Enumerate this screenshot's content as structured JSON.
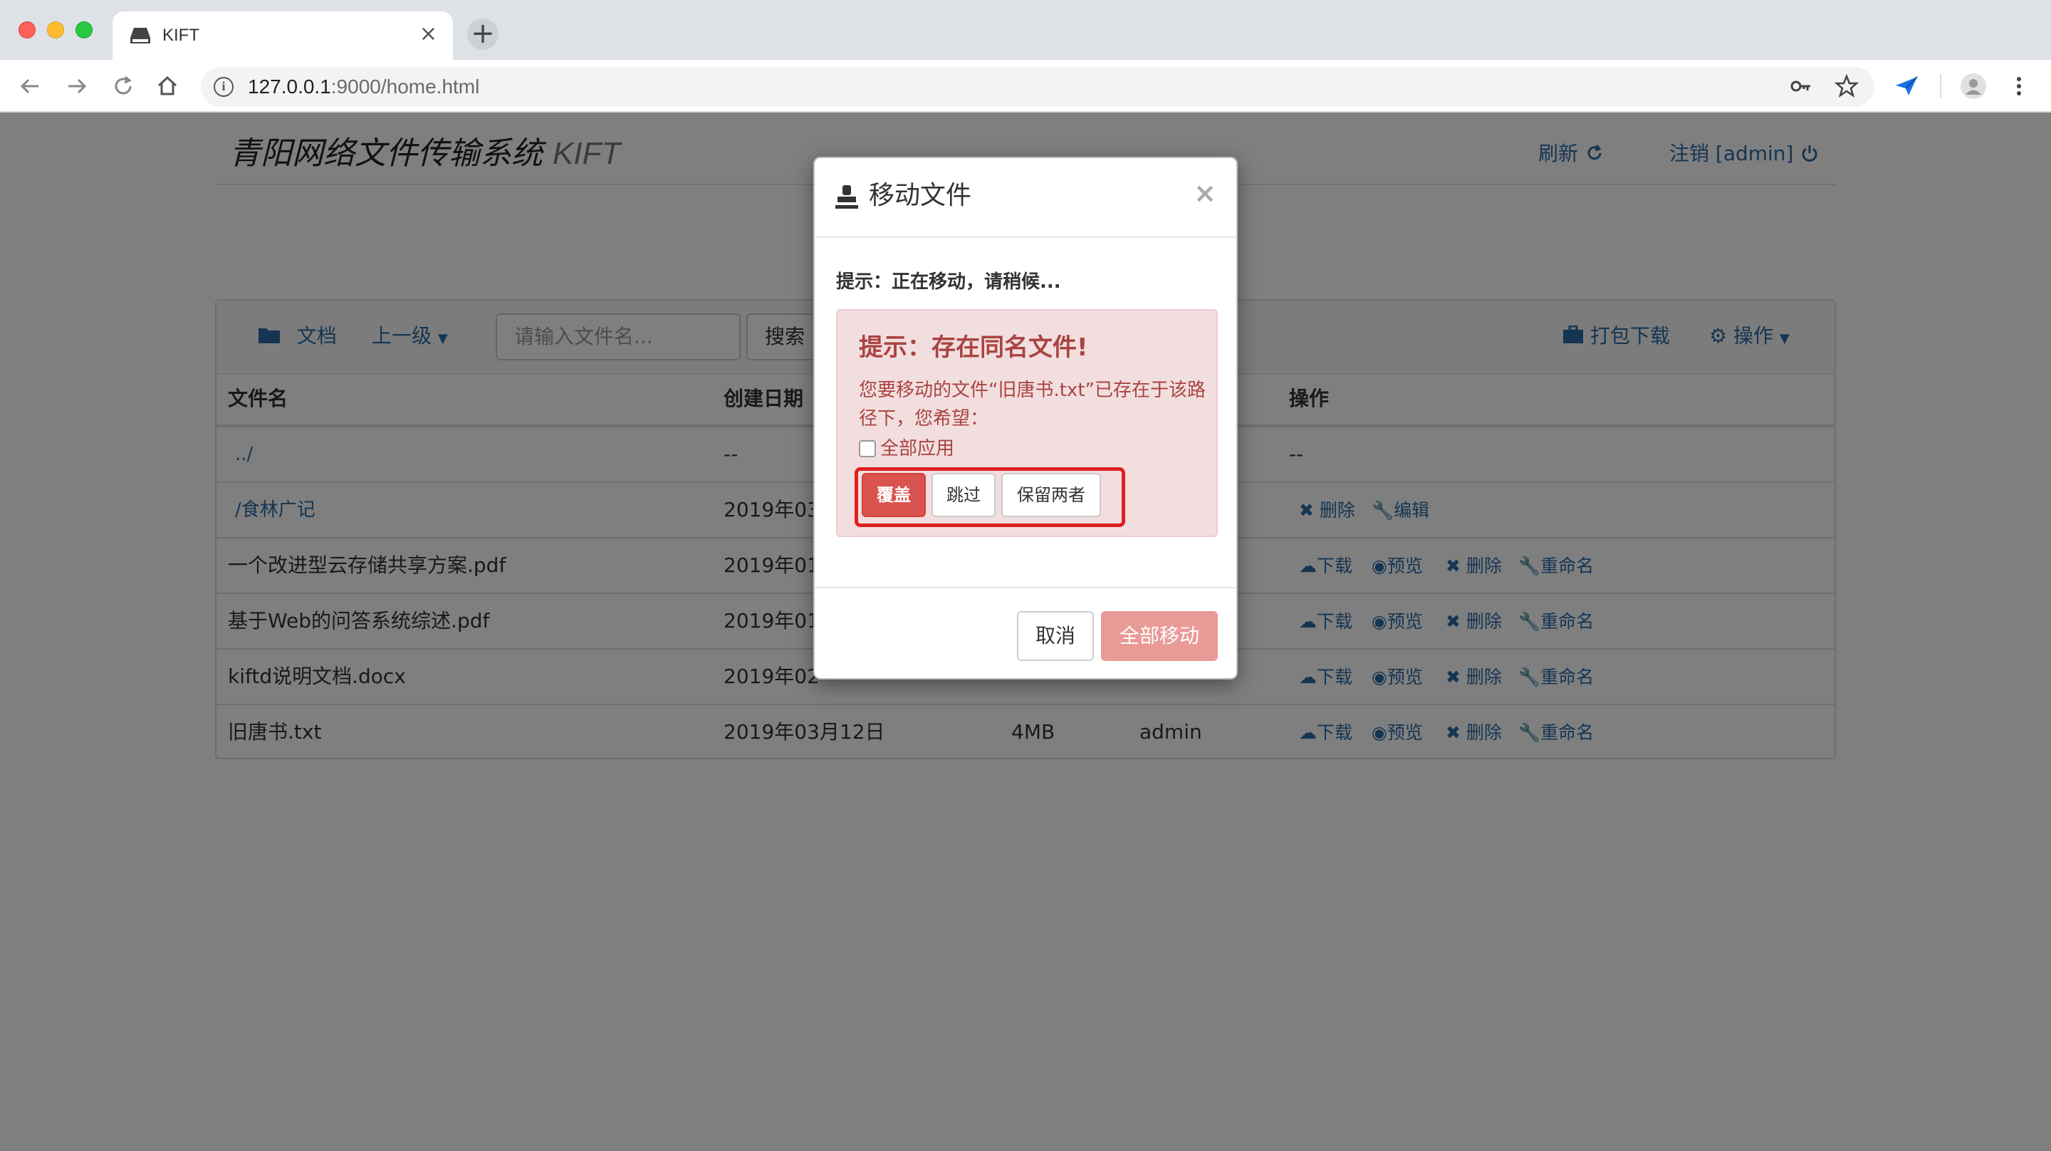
{
  "browser": {
    "tab_title": "KIFT",
    "url_host": "127.0.0.1",
    "url_path": ":9000/home.html"
  },
  "page": {
    "brand_title": "青阳网络文件传输系统",
    "brand_sub": "KIFT",
    "refresh_label": "刷新",
    "logout_label": "注销 [admin]",
    "toolbar": {
      "folder_label": "文档",
      "parent_label": "上一级",
      "search_placeholder": "请输入文件名...",
      "search_button": "搜索",
      "package_download": "打包下载",
      "operations": "操作"
    },
    "columns": {
      "name": "文件名",
      "created": "创建日期",
      "actions": "操作"
    },
    "rows": [
      {
        "name": "../",
        "date": "--",
        "size": "",
        "creator": "",
        "actions_text": "--"
      },
      {
        "name": "/食林广记",
        "date": "2019年03",
        "size": "",
        "creator": ""
      },
      {
        "name": "一个改进型云存储共享方案.pdf",
        "date": "2019年01",
        "size": "",
        "creator": ""
      },
      {
        "name": "基于Web的问答系统综述.pdf",
        "date": "2019年01",
        "size": "",
        "creator": ""
      },
      {
        "name": "kiftd说明文档.docx",
        "date": "2019年02",
        "size": "",
        "creator": ""
      },
      {
        "name": "旧唐书.txt",
        "date": "2019年03月12日",
        "size": "4MB",
        "creator": "admin"
      }
    ],
    "actions": {
      "download": "下载",
      "preview": "预览",
      "delete": "删除",
      "rename": "重命名",
      "edit": "编辑"
    }
  },
  "modal": {
    "title": "移动文件",
    "close": "×",
    "status": "提示：正在移动，请稍候...",
    "alert_title": "提示：存在同名文件!",
    "alert_message": "您要移动的文件“旧唐书.txt”已存在于该路径下，您希望：",
    "apply_all_label": "全部应用",
    "apply_all_checked": false,
    "overwrite_button": "覆盖",
    "skip_button": "跳过",
    "keep_both_button": "保留两者",
    "cancel_button": "取消",
    "move_all_button": "全部移动"
  },
  "colors": {
    "link": "#2a6aa5",
    "danger": "#d9534f",
    "alert_bg": "#f2dede",
    "alert_text": "#a94442",
    "highlight": "#e02020"
  }
}
